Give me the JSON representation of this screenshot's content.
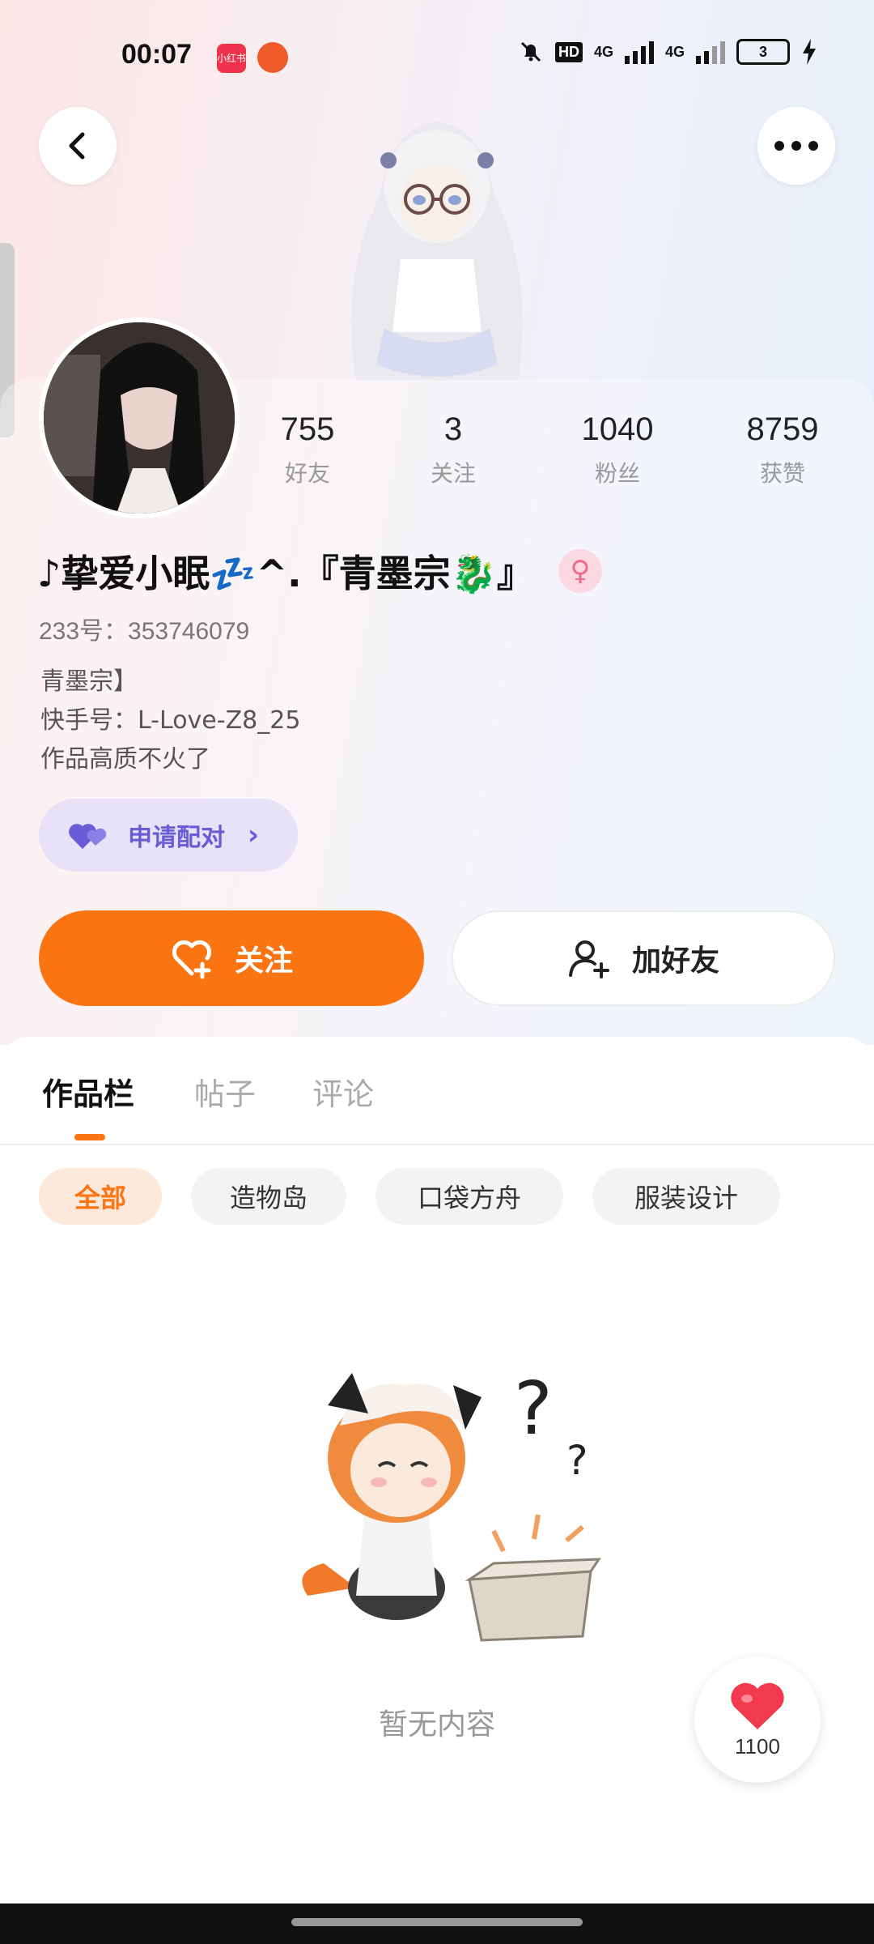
{
  "status_bar": {
    "time": "00:07",
    "app1_label": "小红书",
    "hd_label": "HD",
    "net1": "4G",
    "net2": "4G",
    "battery": "3"
  },
  "profile": {
    "stats": [
      {
        "value": "755",
        "label": "好友"
      },
      {
        "value": "3",
        "label": "关注"
      },
      {
        "value": "1040",
        "label": "粉丝"
      },
      {
        "value": "8759",
        "label": "获赞"
      }
    ],
    "nickname": "♪挚爱小眠💤^.『青墨宗🐉』",
    "gender_symbol": "♀",
    "uid": "233号：353746079",
    "bio_lines": [
      "青墨宗】",
      "快手号：L-Love-Z8_25",
      "作品高质不火了"
    ],
    "pair_label": "申请配对",
    "follow_label": "关注",
    "add_friend_label": "加好友"
  },
  "tabs": [
    {
      "label": "作品栏",
      "active": true
    },
    {
      "label": "帖子",
      "active": false
    },
    {
      "label": "评论",
      "active": false
    }
  ],
  "chips": [
    {
      "label": "全部",
      "active": true
    },
    {
      "label": "造物岛",
      "active": false
    },
    {
      "label": "口袋方舟",
      "active": false
    },
    {
      "label": "服装设计",
      "active": false
    }
  ],
  "empty_text": "暂无内容",
  "like_count": "1100",
  "colors": {
    "accent": "#fb7412",
    "pair": "#6a5bd6"
  }
}
